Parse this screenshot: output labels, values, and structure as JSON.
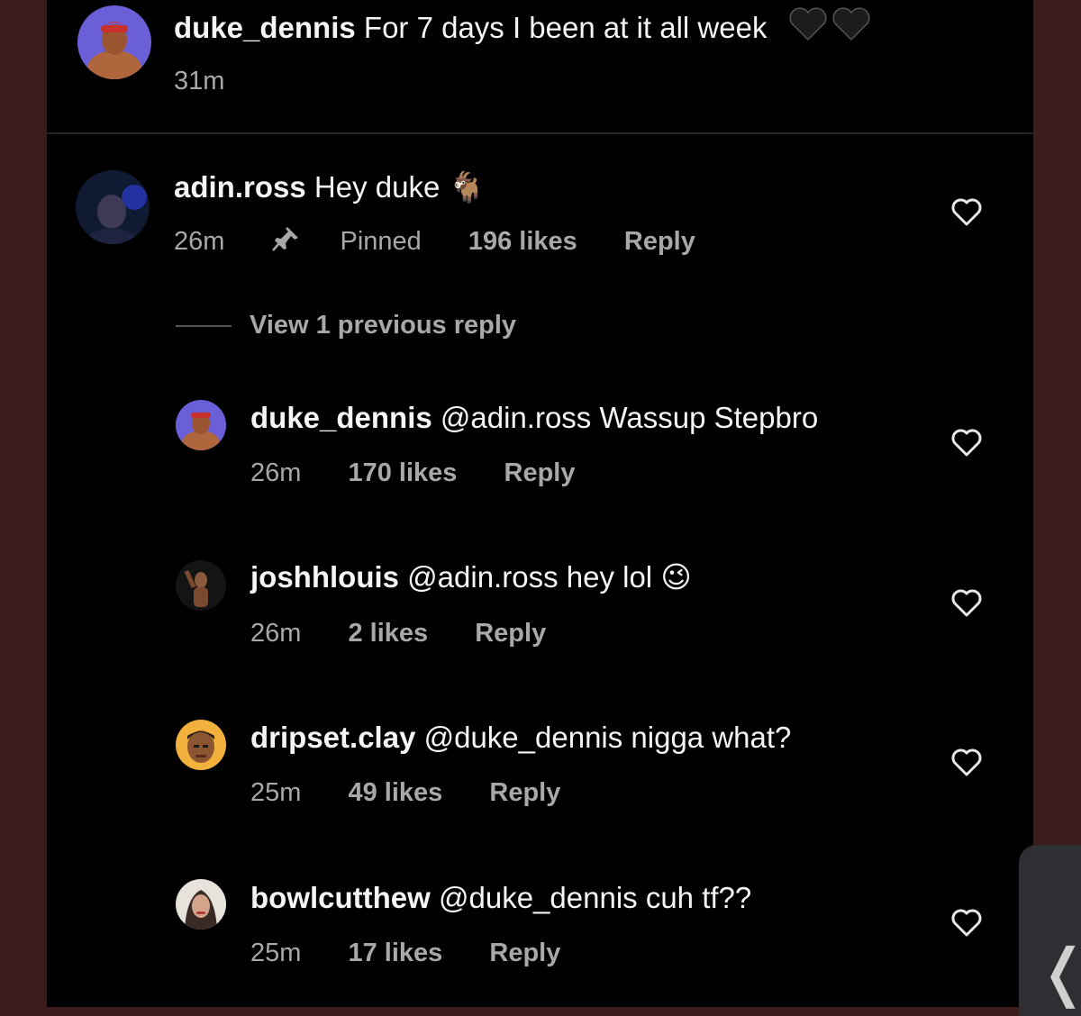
{
  "caption": {
    "username": "duke_dennis",
    "text": "For 7 days I been at it all week",
    "emoji": "🖤🖤",
    "time": "31m"
  },
  "comments": [
    {
      "username": "adin.ross",
      "text": "Hey duke",
      "emoji": "🐐",
      "time": "26m",
      "pinned_label": "Pinned",
      "likes": "196 likes",
      "reply_label": "Reply"
    }
  ],
  "view_previous": "View 1 previous reply",
  "replies": [
    {
      "username": "duke_dennis",
      "text": "@adin.ross Wassup Stepbro",
      "emoji": "",
      "time": "26m",
      "likes": "170 likes",
      "reply_label": "Reply"
    },
    {
      "username": "joshhlouis",
      "text": "@adin.ross hey lol",
      "emoji": "😉",
      "time": "26m",
      "likes": "2 likes",
      "reply_label": "Reply"
    },
    {
      "username": "dripset.clay",
      "text": "@duke_dennis nigga what?",
      "emoji": "",
      "time": "25m",
      "likes": "49 likes",
      "reply_label": "Reply"
    },
    {
      "username": "bowlcutthew",
      "text": "@duke_dennis cuh tf??",
      "emoji": "",
      "time": "25m",
      "likes": "17 likes",
      "reply_label": "Reply"
    }
  ],
  "side_tab": {
    "icon": "chevron-left-icon",
    "glyph": "❬"
  },
  "colors": {
    "background": "#000000",
    "secondary_text": "#a8a8a8",
    "outer": "#3a1c1a"
  }
}
